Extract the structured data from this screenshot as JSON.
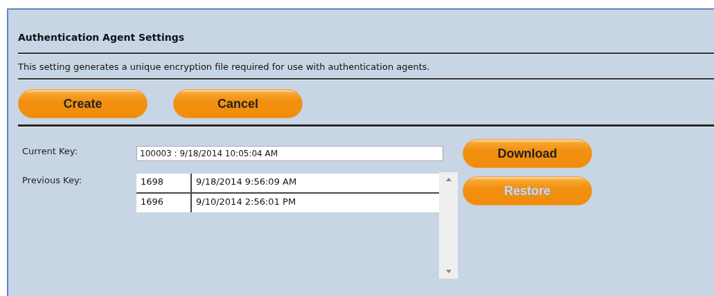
{
  "title": "Authentication Agent Settings",
  "description": "This setting generates a unique encryption file required for use with authentication agents.",
  "actions": [
    {
      "label": "Create",
      "disabled": false
    },
    {
      "label": "Cancel",
      "disabled": false
    }
  ],
  "current_key": {
    "label": "Current Key:",
    "value": "100003 : 9/18/2014 10:05:04 AM"
  },
  "previous_key": {
    "label": "Previous Key:",
    "rows": [
      {
        "id": "1698",
        "date": "9/18/2014 9:56:09 AM"
      },
      {
        "id": "1696",
        "date": "9/10/2014 2:56:01 PM"
      }
    ]
  },
  "side_buttons": [
    {
      "label": "Download",
      "disabled": false
    },
    {
      "label": "Restore",
      "disabled": true
    }
  ]
}
